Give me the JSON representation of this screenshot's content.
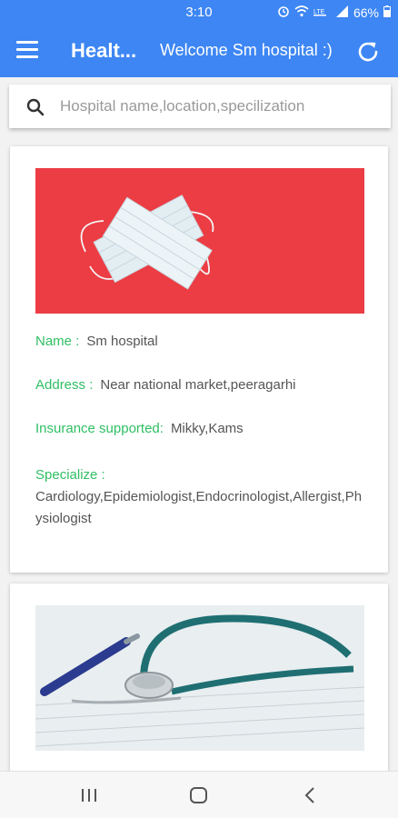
{
  "status_bar": {
    "time": "3:10",
    "battery": "66%"
  },
  "app_bar": {
    "title": "Healt...",
    "welcome": "Welcome Sm hospital :)"
  },
  "search": {
    "placeholder": "Hospital name,location,specilization"
  },
  "hospitals": [
    {
      "name_label": "Name :",
      "name": "Sm hospital",
      "address_label": "Address :",
      "address": "Near national market,peeragarhi",
      "insurance_label": "Insurance supported:",
      "insurance": "Mikky,Kams",
      "specialize_label": "Specialize :",
      "specialize": "Cardiology,Epidemiologist,Endocrinologist,Allergist,Physiologist"
    }
  ],
  "colors": {
    "primary": "#3d86f3",
    "label_green": "#2fbf64",
    "card_image_red": "#ec3c44"
  },
  "icons": {
    "menu": "hamburger-menu-icon",
    "refresh": "refresh-icon",
    "search": "search-icon",
    "nav_recents": "recents-icon",
    "nav_home": "home-icon",
    "nav_back": "back-icon"
  }
}
